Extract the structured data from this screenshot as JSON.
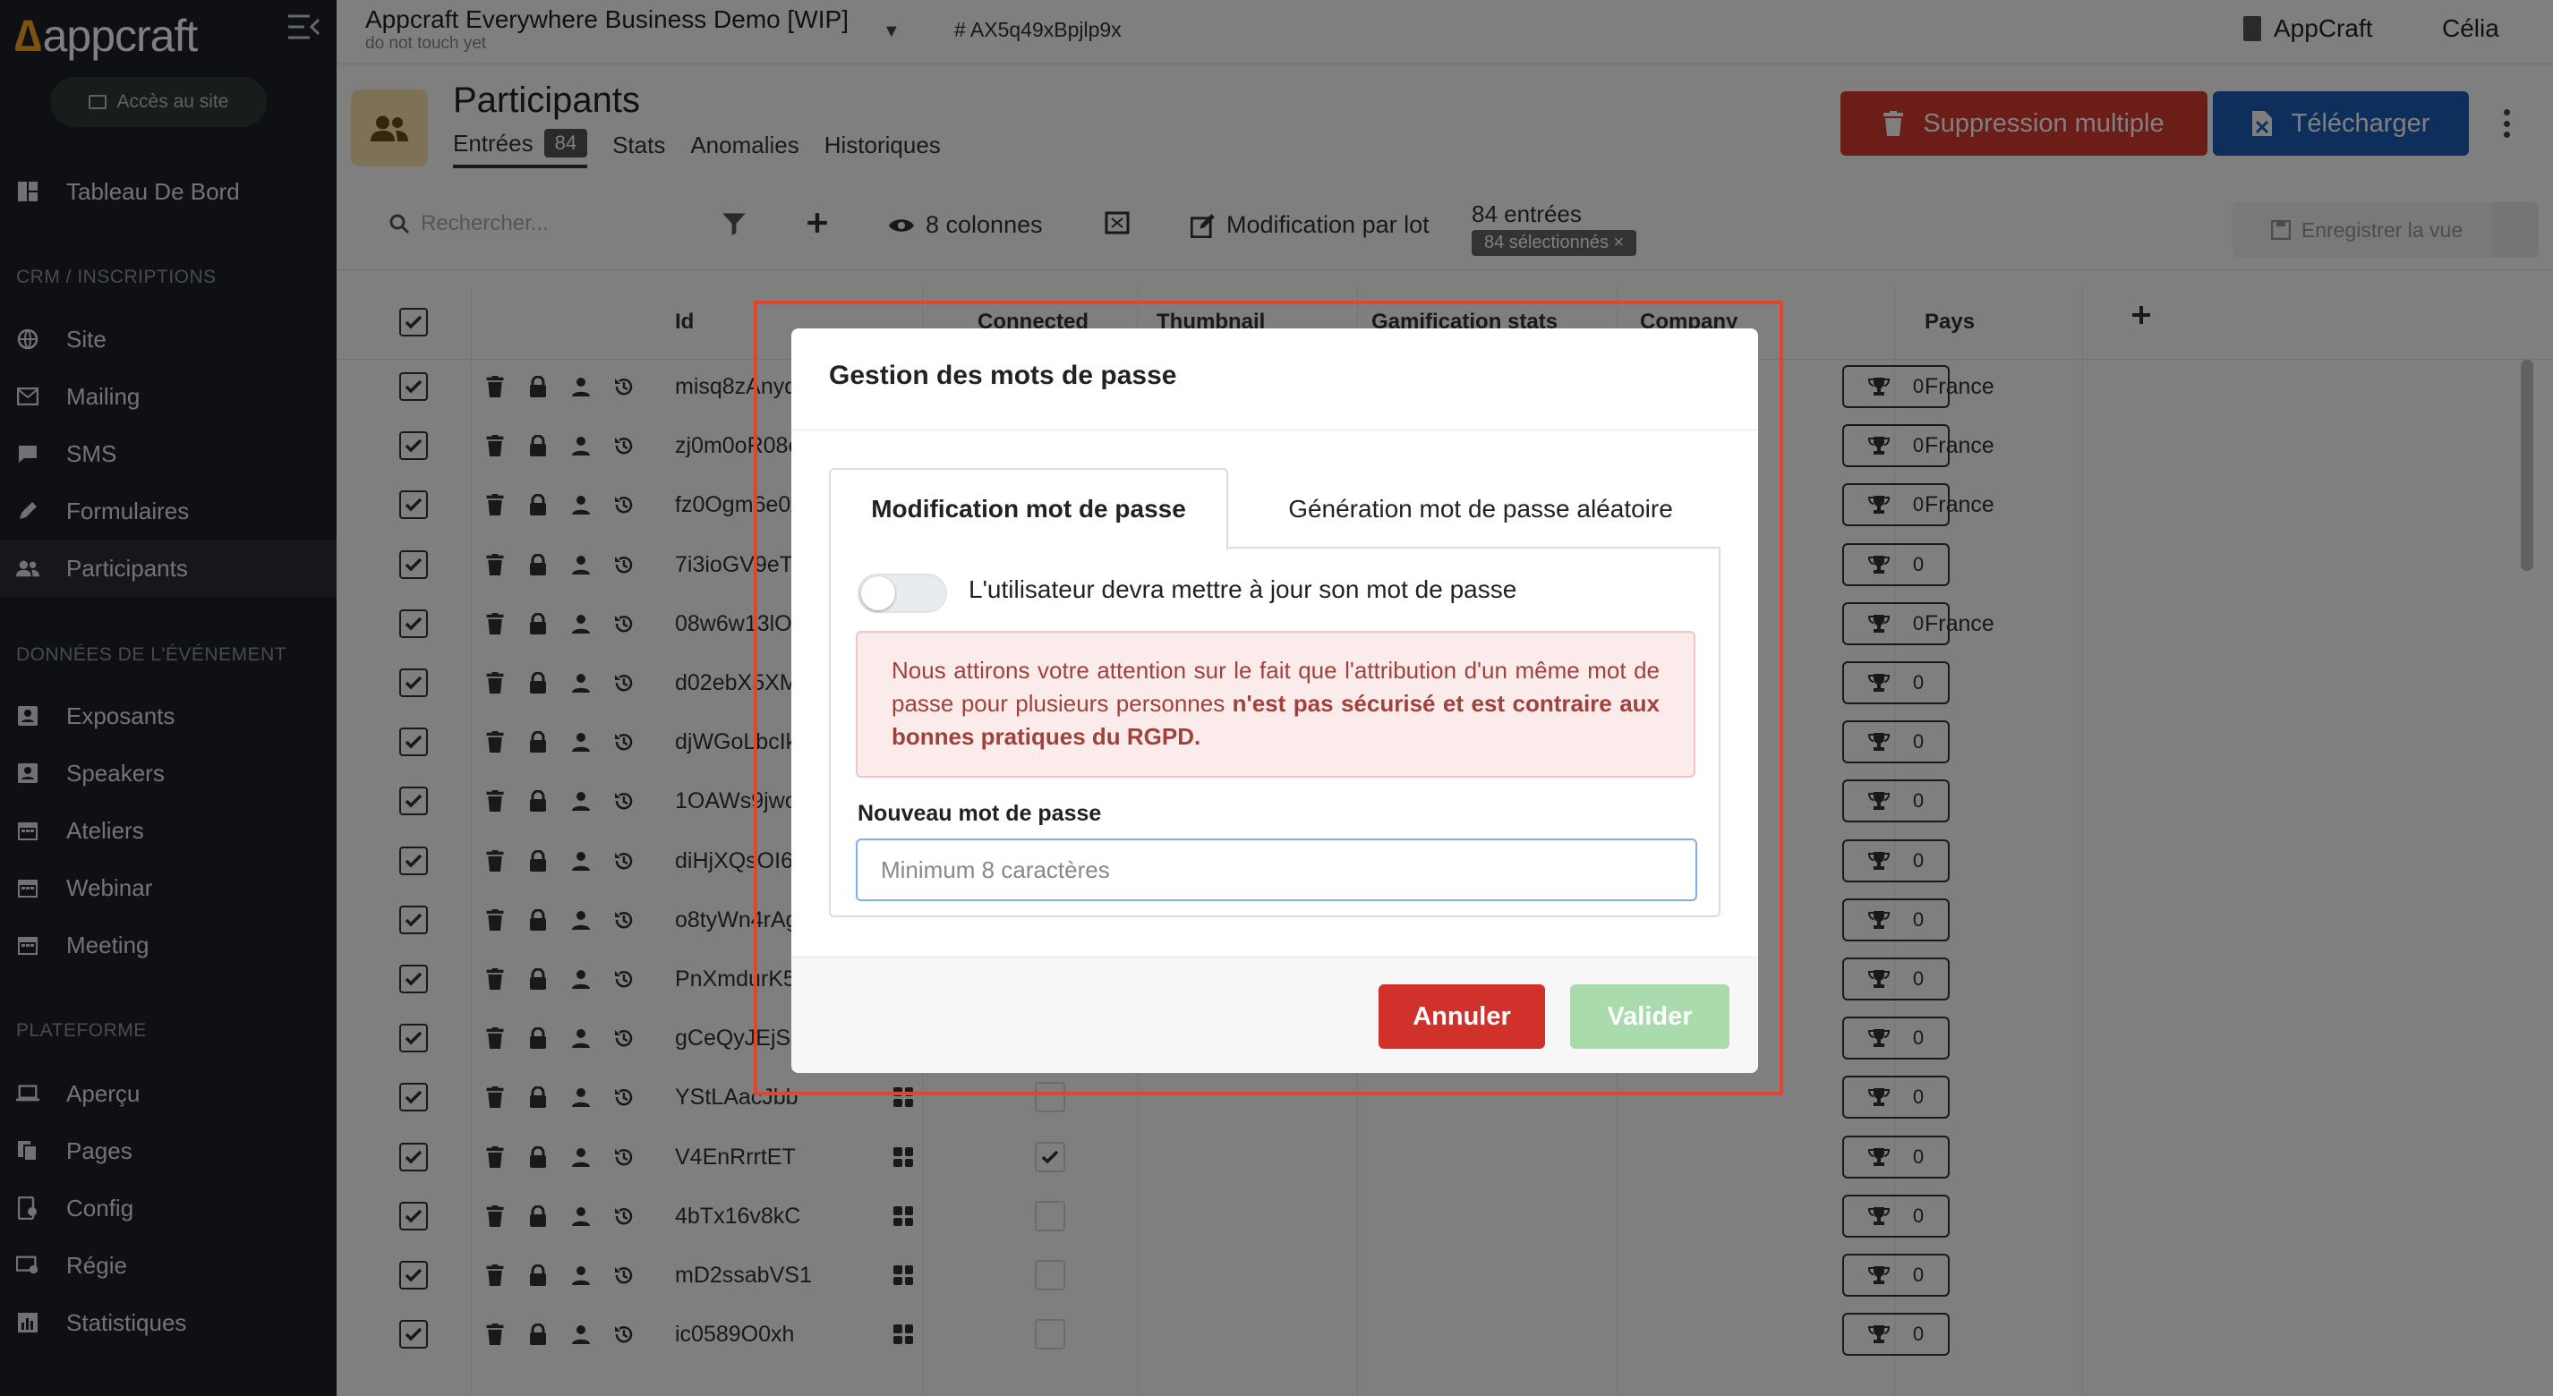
{
  "app": {
    "logo_text": "appcraft",
    "site_button": "Accès au site"
  },
  "sidebar": {
    "items": [
      {
        "label": "Tableau De Bord",
        "icon": "dashboard-icon"
      },
      {
        "label": "Site",
        "icon": "globe-icon"
      },
      {
        "label": "Mailing",
        "icon": "mail-icon"
      },
      {
        "label": "SMS",
        "icon": "chat-icon"
      },
      {
        "label": "Formulaires",
        "icon": "pencil-icon"
      },
      {
        "label": "Participants",
        "icon": "users-icon"
      },
      {
        "label": "Exposants",
        "icon": "id-card-icon"
      },
      {
        "label": "Speakers",
        "icon": "id-card-icon"
      },
      {
        "label": "Ateliers",
        "icon": "calendar-icon"
      },
      {
        "label": "Webinar",
        "icon": "calendar-icon"
      },
      {
        "label": "Meeting",
        "icon": "calendar-icon"
      },
      {
        "label": "Aperçu",
        "icon": "laptop-icon"
      },
      {
        "label": "Pages",
        "icon": "pages-icon"
      },
      {
        "label": "Config",
        "icon": "phone-config-icon"
      },
      {
        "label": "Régie",
        "icon": "broadcast-icon"
      },
      {
        "label": "Statistiques",
        "icon": "chart-icon"
      }
    ],
    "sections": [
      "CRM / INSCRIPTIONS",
      "DONNÉES DE L'ÉVÉNEMENT",
      "PLATEFORME"
    ]
  },
  "topbar": {
    "project_title": "Appcraft Everywhere Business Demo [WIP]",
    "project_subtitle": "do not touch yet",
    "project_hash": "# AX5q49xBpjlp9x",
    "org_name": "AppCraft",
    "user_name": "Célia"
  },
  "page": {
    "title": "Participants",
    "tabs": [
      {
        "label": "Entrées",
        "badge": "84"
      },
      {
        "label": "Stats"
      },
      {
        "label": "Anomalies"
      },
      {
        "label": "Historiques"
      }
    ],
    "delete_button": "Suppression multiple",
    "download_button": "Télécharger"
  },
  "toolbar": {
    "search_placeholder": "Rechercher...",
    "columns_label": "8 colonnes",
    "batch_label": "Modification par lot",
    "entries_count": "84 entrées",
    "selected_label": "84 sélectionnés ×",
    "save_view": "Enregistrer la vue"
  },
  "table": {
    "headers": [
      "Id",
      "Connected",
      "Thumbnail",
      "Gamification stats",
      "Company",
      "Pays"
    ],
    "rows": [
      {
        "id": "misq8zAnyq",
        "country": "France"
      },
      {
        "id": "zj0m0oR08e",
        "country": "France"
      },
      {
        "id": "fz0Ogm6e0A",
        "country": "France"
      },
      {
        "id": "7i3ioGV9eT",
        "country": ""
      },
      {
        "id": "08w6w13lOx",
        "country": "France"
      },
      {
        "id": "d02ebX5XMh",
        "country": ""
      },
      {
        "id": "djWGoLbcIk",
        "country": ""
      },
      {
        "id": "1OAWs9jwoP",
        "country": ""
      },
      {
        "id": "diHjXQsOI6",
        "country": ""
      },
      {
        "id": "o8tyWn4rAg",
        "country": ""
      },
      {
        "id": "PnXmdurK5e",
        "country": ""
      },
      {
        "id": "gCeQyJEjSu",
        "country": ""
      },
      {
        "id": "YStLAacJbb",
        "country": "",
        "score": "0"
      },
      {
        "id": "V4EnRrrtET",
        "country": "",
        "score": "0",
        "connected": true
      },
      {
        "id": "4bTx16v8kC",
        "country": "",
        "score": "0"
      },
      {
        "id": "mD2ssabVS1",
        "country": "",
        "score": "0"
      },
      {
        "id": "ic0589O0xh",
        "country": "",
        "score": "0"
      }
    ]
  },
  "modal": {
    "title": "Gestion des mots de passe",
    "tab_active": "Modification mot de passe",
    "tab_inactive": "Génération mot de passe aléatoire",
    "toggle_label": "L'utilisateur devra mettre à jour son mot de passe",
    "toggle_on": false,
    "alert_text": "Nous attirons votre attention sur le fait que l'attribution d'un même mot de passe pour plusieurs personnes ",
    "alert_bold": "n'est pas sécurisé et est contraire aux bonnes pratiques du RGPD.",
    "field_label": "Nouveau mot de passe",
    "field_placeholder": "Minimum 8 caractères",
    "field_value": "",
    "cancel_label": "Annuler",
    "confirm_label": "Valider"
  },
  "colors": {
    "danger": "#d0322b",
    "primary": "#1d5fb6",
    "success_disabled": "#a9dbad",
    "highlight": "#e8412c"
  }
}
